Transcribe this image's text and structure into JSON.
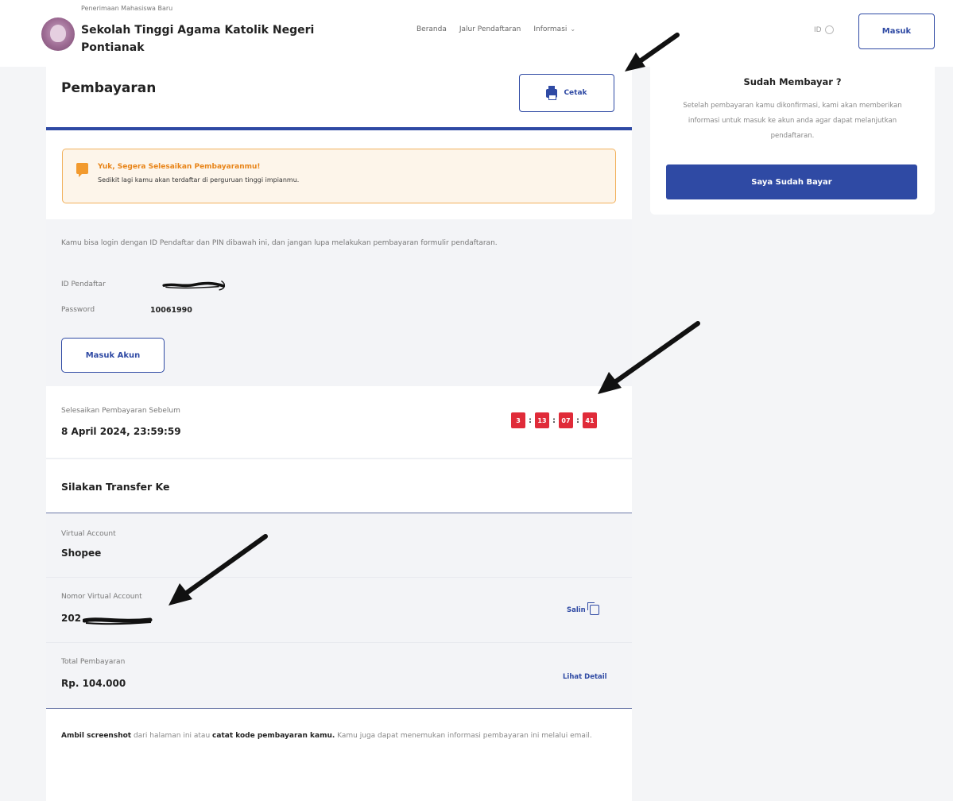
{
  "header": {
    "tagline": "Penerimaan Mahasiswa Baru",
    "institution": "Sekolah Tinggi Agama Katolik Negeri Pontianak",
    "nav": [
      "Beranda",
      "Jalur Pendaftaran",
      "Informasi"
    ],
    "lang": "ID",
    "login_label": "Masuk"
  },
  "payment": {
    "title": "Pembayaran",
    "print_label": "Cetak",
    "alert_title": "Yuk, Segera Selesaikan Pembayaranmu!",
    "alert_desc": "Sedikit lagi kamu akan terdaftar di perguruan tinggi impianmu.",
    "info_text": "Kamu bisa login dengan ID Pendaftar dan PIN dibawah ini, dan jangan lupa melakukan pembayaran formulir pendaftaran.",
    "id_label": "ID Pendaftar",
    "password_label": "Password",
    "password_value": "10061990",
    "account_button": "Masuk Akun",
    "deadline_label": "Selesaikan Pembayaran Sebelum",
    "deadline_value": "8 April 2024, 23:59:59",
    "timer": [
      "3",
      "13",
      "07",
      "41"
    ],
    "transfer_title": "Silakan Transfer Ke",
    "va_label": "Virtual Account",
    "va_value": "Shopee",
    "va_number_label": "Nomor Virtual Account",
    "va_number_value": "202",
    "copy_label": "Salin",
    "total_label": "Total Pembayaran",
    "total_value": "Rp. 104.000",
    "detail_label": "Lihat Detail",
    "note_bold1": "Ambil screenshot",
    "note_mid": " dari halaman ini atau ",
    "note_bold2": "catat kode pembayaran kamu.",
    "note_end": " Kamu juga dapat menemukan informasi pembayaran ini melalui email."
  },
  "side": {
    "title": "Sudah Membayar ?",
    "text": "Setelah pembayaran kamu dikonfirmasi, kami akan memberikan informasi untuk masuk ke akun anda agar dapat melanjutkan pendaftaran.",
    "button": "Saya Sudah Bayar"
  },
  "colors": {
    "primary": "#2f4aa4",
    "warning": "#f2b15c",
    "timer": "#e02b39"
  }
}
